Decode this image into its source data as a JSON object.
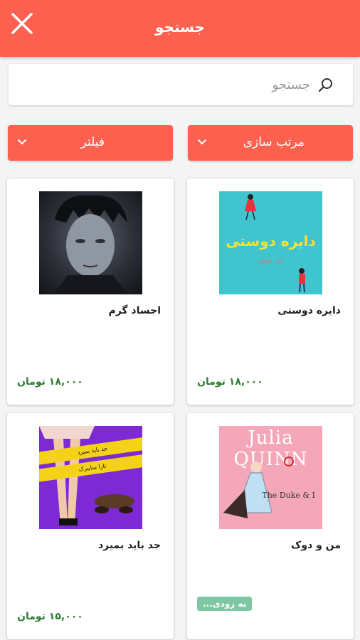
{
  "header": {
    "title": "جستجو"
  },
  "search": {
    "placeholder": "جستجو"
  },
  "controls": {
    "sort_label": "مرتب سازی",
    "filter_label": "فیلتر"
  },
  "colors": {
    "accent": "#fc6150",
    "price": "#2e7d32",
    "soon_badge": "#7ec7a2"
  },
  "books": [
    {
      "name": "دایره دوستی",
      "price": "۱۸,۰۰۰ تومان",
      "cover_title": "دایره دوستی",
      "cover_author": "لی جیمز"
    },
    {
      "name": "اجساد گرم",
      "price": "۱۸,۰۰۰ تومان"
    },
    {
      "name": "من و دوک",
      "badge": "به زودی...",
      "cover_brand": "Julia QUINN",
      "cover_subtitle": "The Duke & I"
    },
    {
      "name": "جد باید بمیرد",
      "price": "۱۵,۰۰۰ تومان",
      "cover_tape_1": "جد باید بمیرد",
      "cover_tape_2": "تارا سایبرک"
    }
  ]
}
